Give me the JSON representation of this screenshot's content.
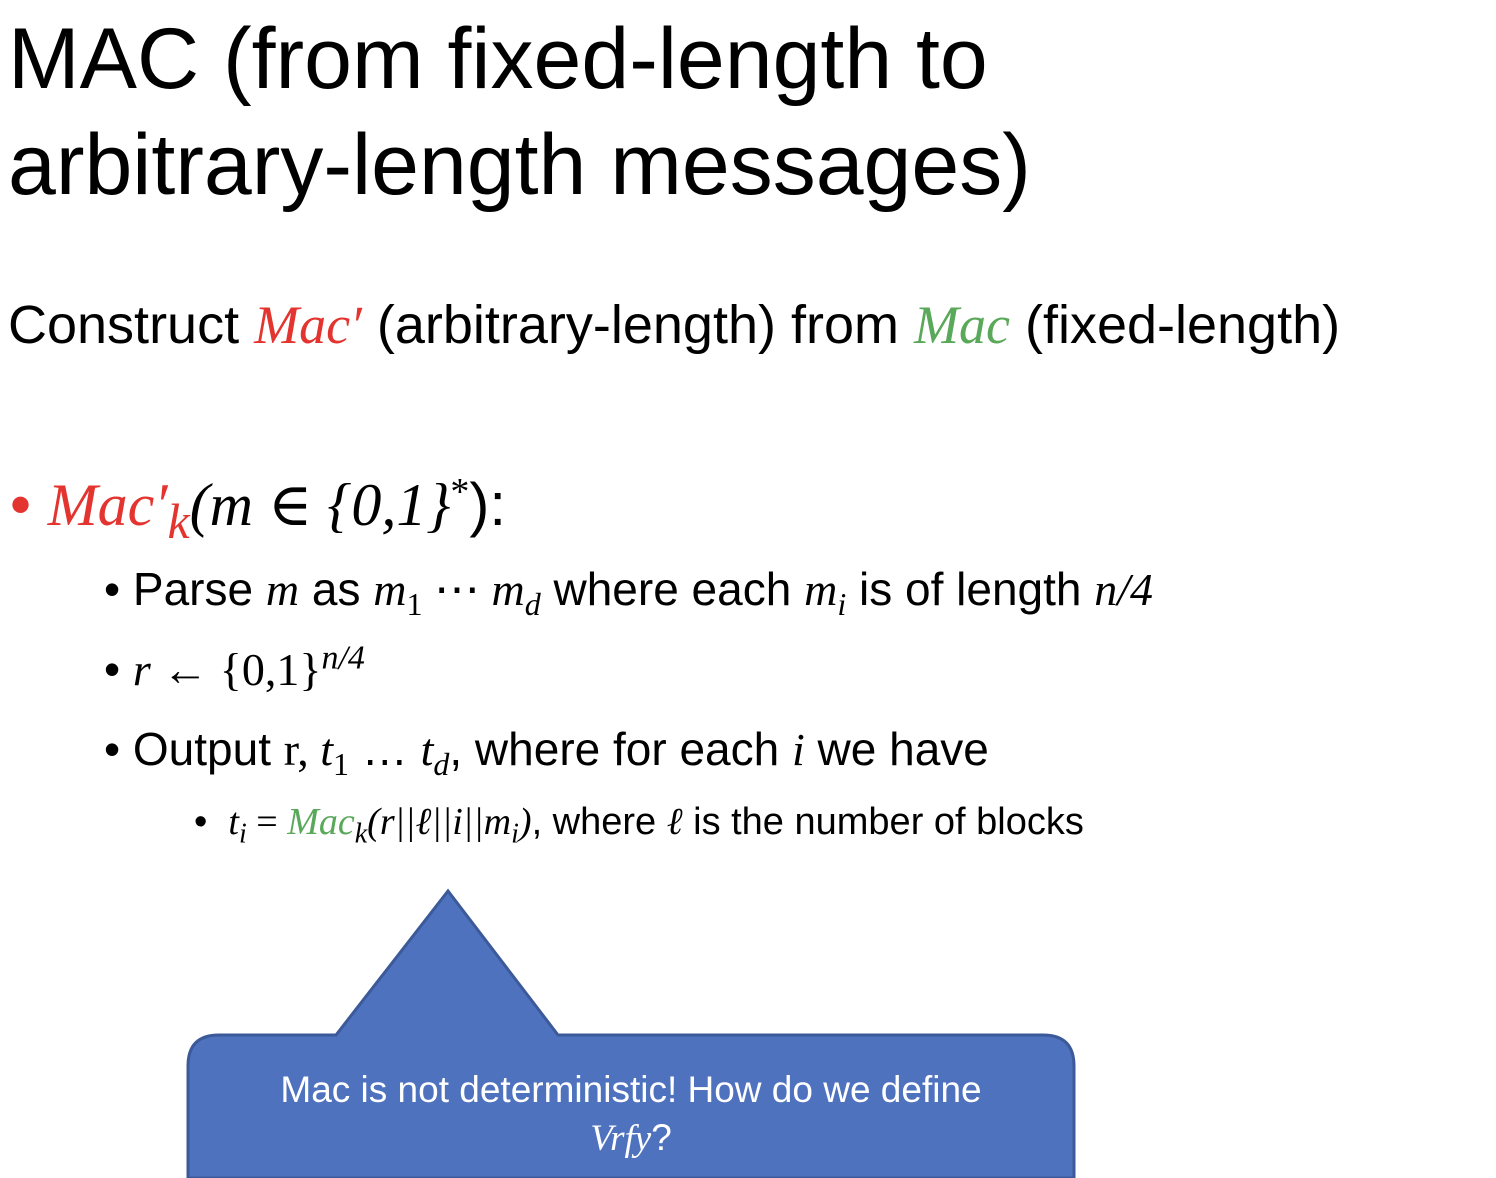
{
  "slide": {
    "title_line1": "MAC (from fixed-length to",
    "title_line2": "arbitrary-length messages)",
    "subtitle": {
      "part1": "Construct ",
      "mac_prime": "Mac′",
      "part2": " (arbitrary-length)  from ",
      "mac": "Mac",
      "part3": " (fixed-length)"
    },
    "bullet1": {
      "mac": "Mac",
      "prime": "′",
      "sub": "k",
      "rest": "(m ∈ {0,1}",
      "sup": "*",
      "end": "):"
    },
    "bullet2a": {
      "t1": "Parse ",
      "m": "m",
      "t2": " as ",
      "m1": "m",
      "s1": "1",
      "dots": " ⋯ ",
      "md": "m",
      "sd": "d",
      "t3": " where each  ",
      "mi": "m",
      "si": "i",
      "t4": " is of length ",
      "len": "n/4"
    },
    "bullet2b": {
      "r": "r",
      "arrow": " ← ",
      "set": "{0,1}",
      "sup": "n/4"
    },
    "bullet2c": {
      "t1": "Output ",
      "r": "r, ",
      "t": "t",
      "s1": "1",
      "dots": " … ",
      "td": "t",
      "sd": "d",
      "t2": ", where for each ",
      "i": "i",
      "t3": " we have"
    },
    "bullet3": {
      "ti": "t",
      "si": "i",
      "eq": " = ",
      "mac": "Mac",
      "sk": "k",
      "args1": "(r||ℓ||i||m",
      "argsub": "i",
      "args2": ")",
      "t1": ", where ",
      "ell": "ℓ",
      "t2": " is the number of blocks"
    },
    "callout": {
      "line1": "Mac is not deterministic! How do we define",
      "vrfy": "Vrfy",
      "q": "?"
    }
  },
  "colors": {
    "red": "#e3342f",
    "green": "#5aa85a",
    "callout_fill": "#4f72bf",
    "callout_stroke": "#3c5a99"
  }
}
